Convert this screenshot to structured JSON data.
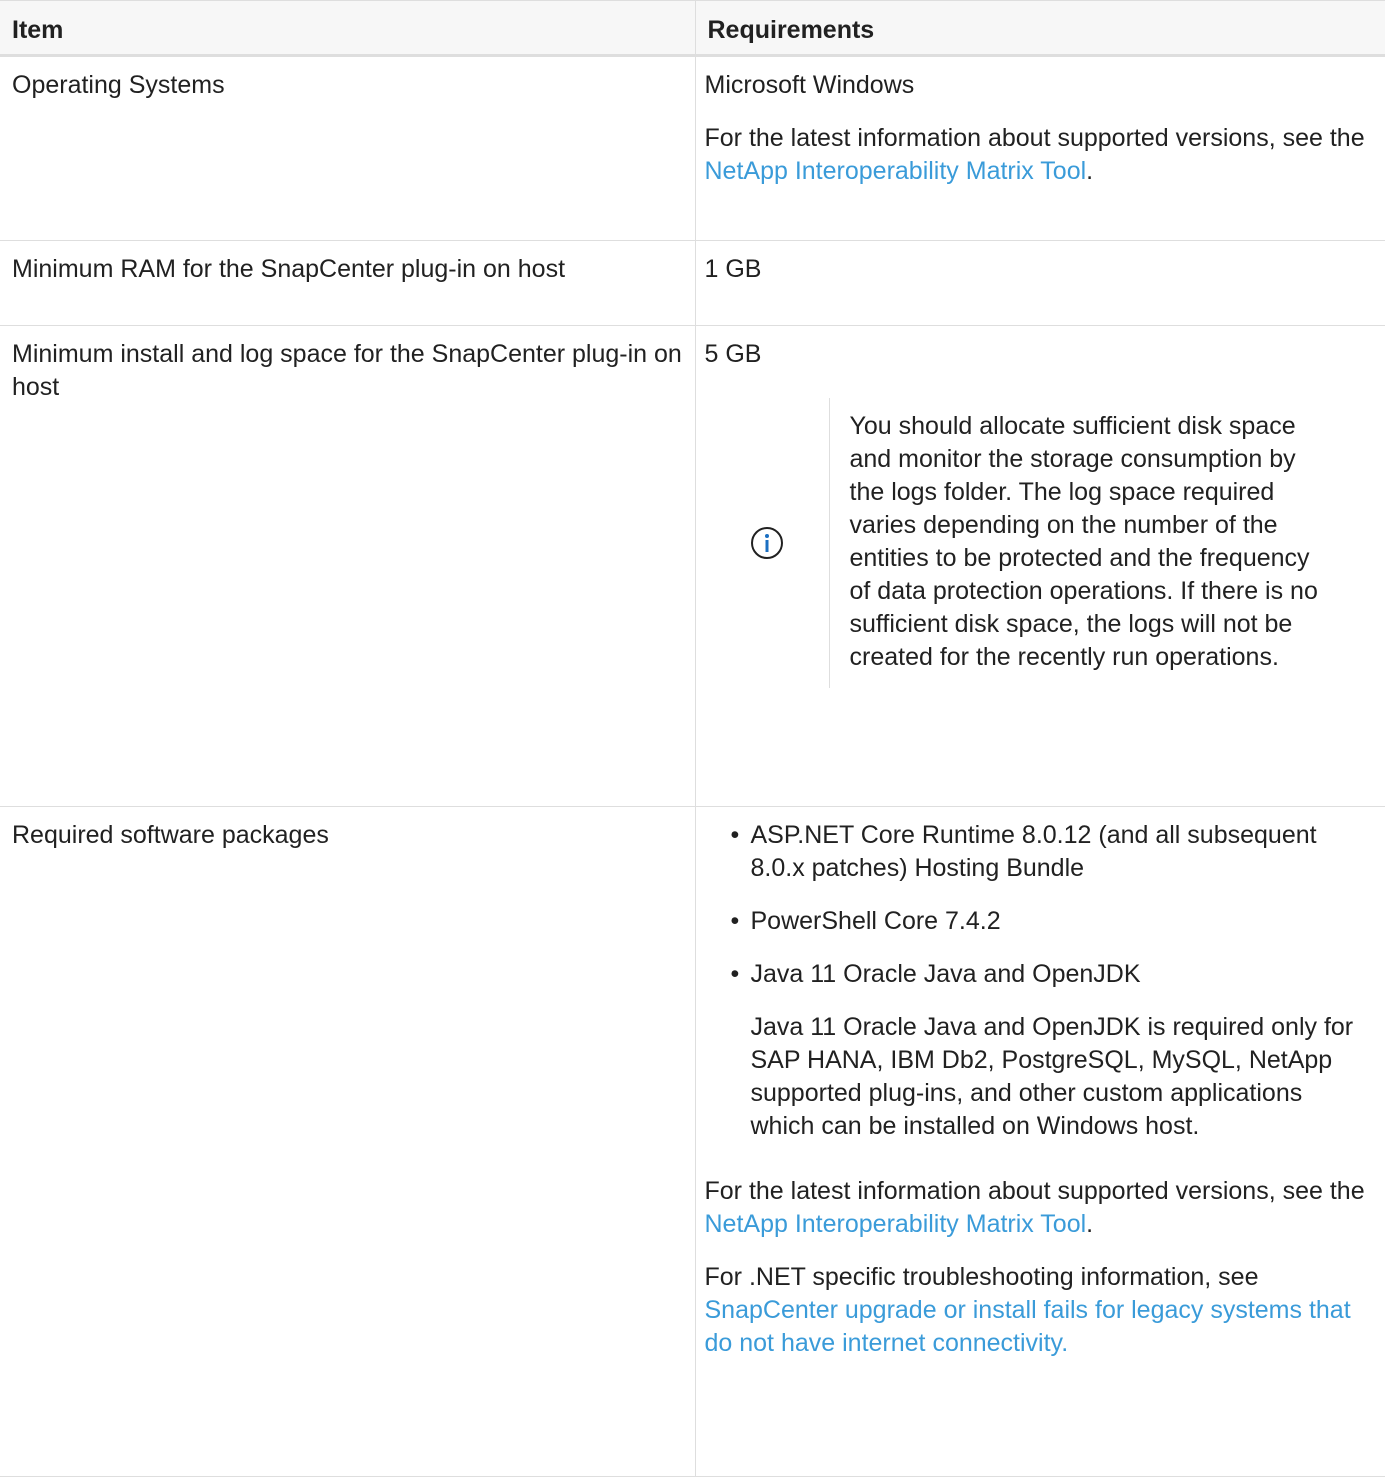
{
  "table": {
    "headers": {
      "item": "Item",
      "requirements": "Requirements"
    },
    "rows": [
      {
        "item": "Operating Systems",
        "req_p1": "Microsoft Windows",
        "req_p2_pre": "For the latest information about supported versions, see the ",
        "req_p2_link": "NetApp Interoperability Matrix Tool",
        "req_p2_post": "."
      },
      {
        "item": "Minimum RAM for the SnapCenter plug-in on host",
        "req_p1": "1 GB"
      },
      {
        "item": "Minimum install and log space for the SnapCenter plug-in on host",
        "req_p1": "5 GB",
        "note_icon": "info-circle-icon",
        "note_text": "You should allocate sufficient disk space and monitor the storage consumption by the logs folder. The log space required varies depending on the number of the entities to be protected and the frequency of data protection operations. If there is no sufficient disk space, the logs will not be created for the recently run operations."
      },
      {
        "item": "Required software packages",
        "packages": [
          "ASP.NET Core Runtime 8.0.12 (and all subsequent 8.0.x patches) Hosting Bundle",
          "PowerShell Core 7.4.2",
          "Java 11 Oracle Java and OpenJDK"
        ],
        "java_note": "Java 11 Oracle Java and OpenJDK is required only for SAP HANA, IBM Db2, PostgreSQL, MySQL, NetApp supported plug-ins, and other custom applications which can be installed on Windows host.",
        "latest_pre": "For the latest information about supported versions, see the ",
        "latest_link": "NetApp Interoperability Matrix Tool",
        "latest_post": ".",
        "net_pre": "For .NET specific troubleshooting information, see ",
        "net_link": "SnapCenter upgrade or install fails for legacy systems that do not have internet connectivity."
      }
    ]
  },
  "colors": {
    "text": "#212121",
    "link": "#3a9bd9",
    "border": "#dedede",
    "header_bg": "#f7f7f7",
    "icon": "#1b6fc2"
  }
}
